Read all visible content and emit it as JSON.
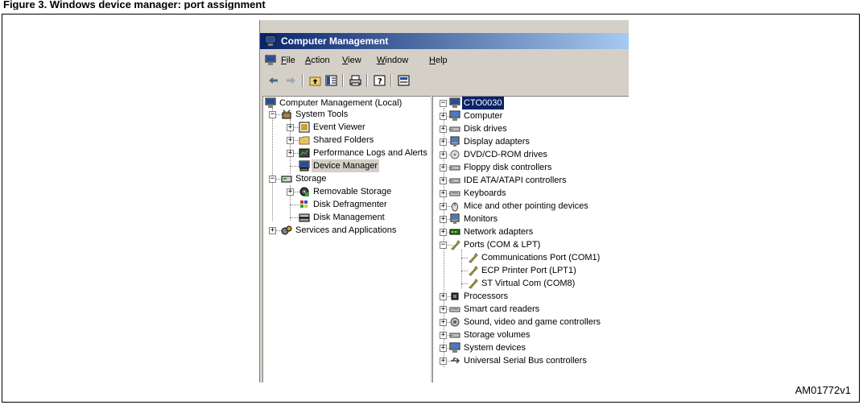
{
  "caption": "Figure 3. Windows device manager: port assignment",
  "figure_id": "AM01772v1",
  "window": {
    "title": "Computer Management",
    "menu": [
      {
        "key": "F",
        "rest": "ile"
      },
      {
        "key": "A",
        "rest": "ction"
      },
      {
        "key": "V",
        "rest": "iew"
      },
      {
        "key": "W",
        "rest": "indow"
      },
      {
        "key": "H",
        "rest": "elp"
      }
    ]
  },
  "left_tree": [
    "Computer Management (Local)",
    "System Tools",
    "Event Viewer",
    "Shared Folders",
    "Performance Logs and Alerts",
    "Device Manager",
    "Storage",
    "Removable Storage",
    "Disk Defragmenter",
    "Disk Management",
    "Services and Applications"
  ],
  "right_tree": [
    "CTO0030",
    "Computer",
    "Disk drives",
    "Display adapters",
    "DVD/CD-ROM drives",
    "Floppy disk controllers",
    "IDE ATA/ATAPI controllers",
    "Keyboards",
    "Mice and other pointing devices",
    "Monitors",
    "Network adapters",
    "Ports (COM & LPT)",
    "Communications Port (COM1)",
    "ECP Printer Port (LPT1)",
    "ST Virtual Com (COM8)",
    "Processors",
    "Smart card readers",
    "Sound, video and game controllers",
    "Storage volumes",
    "System devices",
    "Universal Serial Bus controllers"
  ],
  "colors": {
    "titlebar": "#0a246a",
    "highlight_oval": "#c0282d"
  }
}
